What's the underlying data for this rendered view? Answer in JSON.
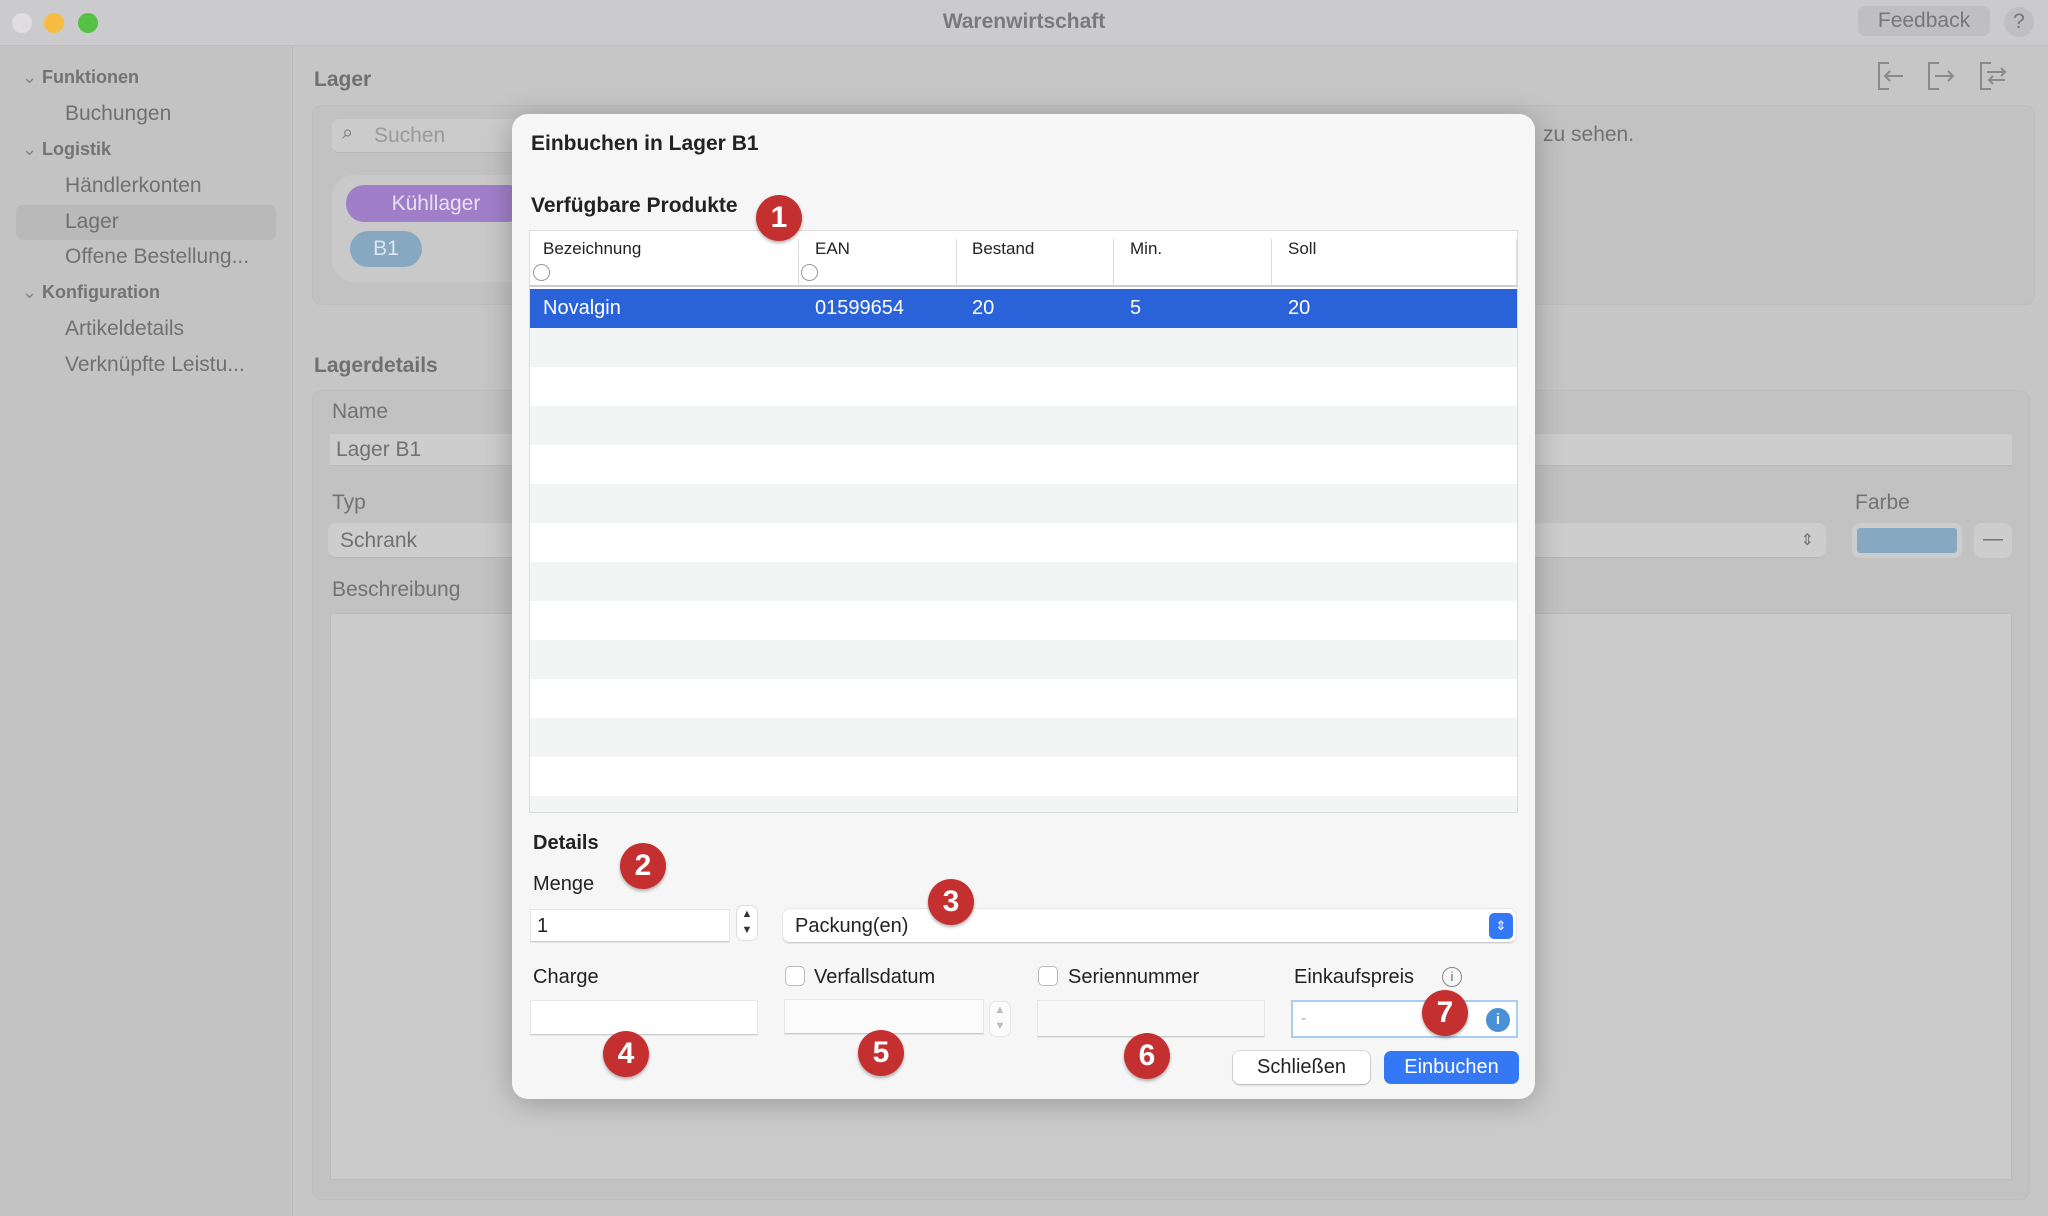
{
  "window": {
    "title": "Warenwirtschaft",
    "feedback": "Feedback",
    "help": "?"
  },
  "sidebar": {
    "sections": [
      {
        "label": "Funktionen",
        "items": [
          "Buchungen"
        ]
      },
      {
        "label": "Logistik",
        "items": [
          "Händlerkonten",
          "Lager",
          "Offene Bestellung..."
        ]
      },
      {
        "label": "Konfiguration",
        "items": [
          "Artikeldetails",
          "Verknüpfte Leistu..."
        ]
      }
    ],
    "selected": "Lager"
  },
  "main": {
    "title": "Lager",
    "toolbar_icons": [
      "import-icon",
      "export-icon",
      "transfer-icon"
    ],
    "search_placeholder": "Suchen",
    "hint_fragment": "zu sehen.",
    "groups": {
      "group": "Kühllager",
      "group_color": "#a07fc8",
      "item": "B1",
      "item_color": "#86a9c1"
    },
    "details_title": "Lagerdetails",
    "name_label": "Name",
    "name_value": "Lager B1",
    "type_label": "Typ",
    "type_value": "Schrank",
    "color_label": "Farbe",
    "color_value": "#86a9c1",
    "description_label": "Beschreibung"
  },
  "dialog": {
    "title": "Einbuchen in Lager B1",
    "products_title": "Verfügbare Produkte",
    "columns": [
      "Bezeichnung",
      "EAN",
      "Bestand",
      "Min.",
      "Soll"
    ],
    "rows": [
      {
        "name": "Novalgin",
        "ean": "01599654",
        "stock": "20",
        "min": "5",
        "target": "20"
      }
    ],
    "details_title": "Details",
    "quantity_label": "Menge",
    "quantity_value": "1",
    "unit_value": "Packung(en)",
    "batch_label": "Charge",
    "expiry_label": "Verfallsdatum",
    "expiry_checked": false,
    "serial_label": "Seriennummer",
    "serial_checked": false,
    "price_label": "Einkaufspreis",
    "price_placeholder": "-",
    "close_button": "Schließen",
    "submit_button": "Einbuchen",
    "accent": "#2a62d9"
  },
  "annotations": [
    "1",
    "2",
    "3",
    "4",
    "5",
    "6",
    "7"
  ]
}
